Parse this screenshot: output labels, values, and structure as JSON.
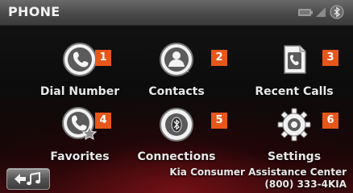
{
  "header": {
    "title": "PHONE"
  },
  "status": {
    "icons": [
      "battery-icon",
      "signal-icon",
      "bluetooth-icon"
    ]
  },
  "menu": [
    {
      "label": "Dial Number",
      "badge": "1",
      "icon": "phone-icon"
    },
    {
      "label": "Contacts",
      "badge": "2",
      "icon": "contacts-icon"
    },
    {
      "label": "Recent Calls",
      "badge": "3",
      "icon": "recent-calls-icon"
    },
    {
      "label": "Favorites",
      "badge": "4",
      "icon": "favorites-icon"
    },
    {
      "label": "Connections",
      "badge": "5",
      "icon": "bluetooth-connections-icon"
    },
    {
      "label": "Settings",
      "badge": "6",
      "icon": "gear-icon"
    }
  ],
  "back_button": {
    "icon": "back-music-icon"
  },
  "footer": {
    "line1": "Kia Consumer Assistance Center",
    "line2": "(800) 333-4KIA"
  },
  "colors": {
    "badge": "#e8571a",
    "header": "#555555",
    "accent_red": "#8c1419"
  }
}
